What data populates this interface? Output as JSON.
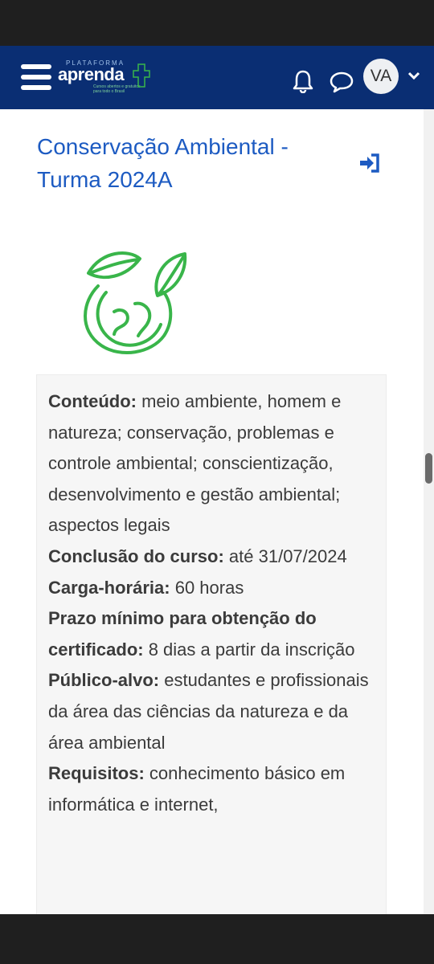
{
  "brand": {
    "platform": "PLATAFORMA",
    "name": "aprenda",
    "tagline": "Cursos abertos e gratuitos para todo o Brasil"
  },
  "header": {
    "avatar_initials": "VA",
    "icons": [
      "menu-icon",
      "bell-icon",
      "chat-icon",
      "chevron-down-icon"
    ]
  },
  "course": {
    "title": "Conservação Ambiental - Turma 2024A",
    "image_icon": "globe-leaves-icon",
    "accent_color": "#39b54a",
    "title_color": "#1d5bc2"
  },
  "summary": {
    "content_label": "Conteúdo:",
    "content_value": " meio ambiente, homem e natureza; conservação, problemas e controle ambiental; conscientização, desenvolvimento e gestão ambiental; aspectos legais",
    "conclusion_label": "Conclusão do curso:",
    "conclusion_value": " até 31/07/2024",
    "workload_label": "Carga-horária:",
    "workload_value": " 60 horas",
    "deadline_label": "Prazo mínimo para obtenção do certificado:",
    "deadline_value": " 8 dias a partir da inscrição",
    "audience_label": "Público-alvo:",
    "audience_value": " estudantes e profissionais da área das ciências da natureza e da área ambiental",
    "requirements_label": "Requisitos:",
    "requirements_value": "  conhecimento básico em informática e internet,"
  }
}
